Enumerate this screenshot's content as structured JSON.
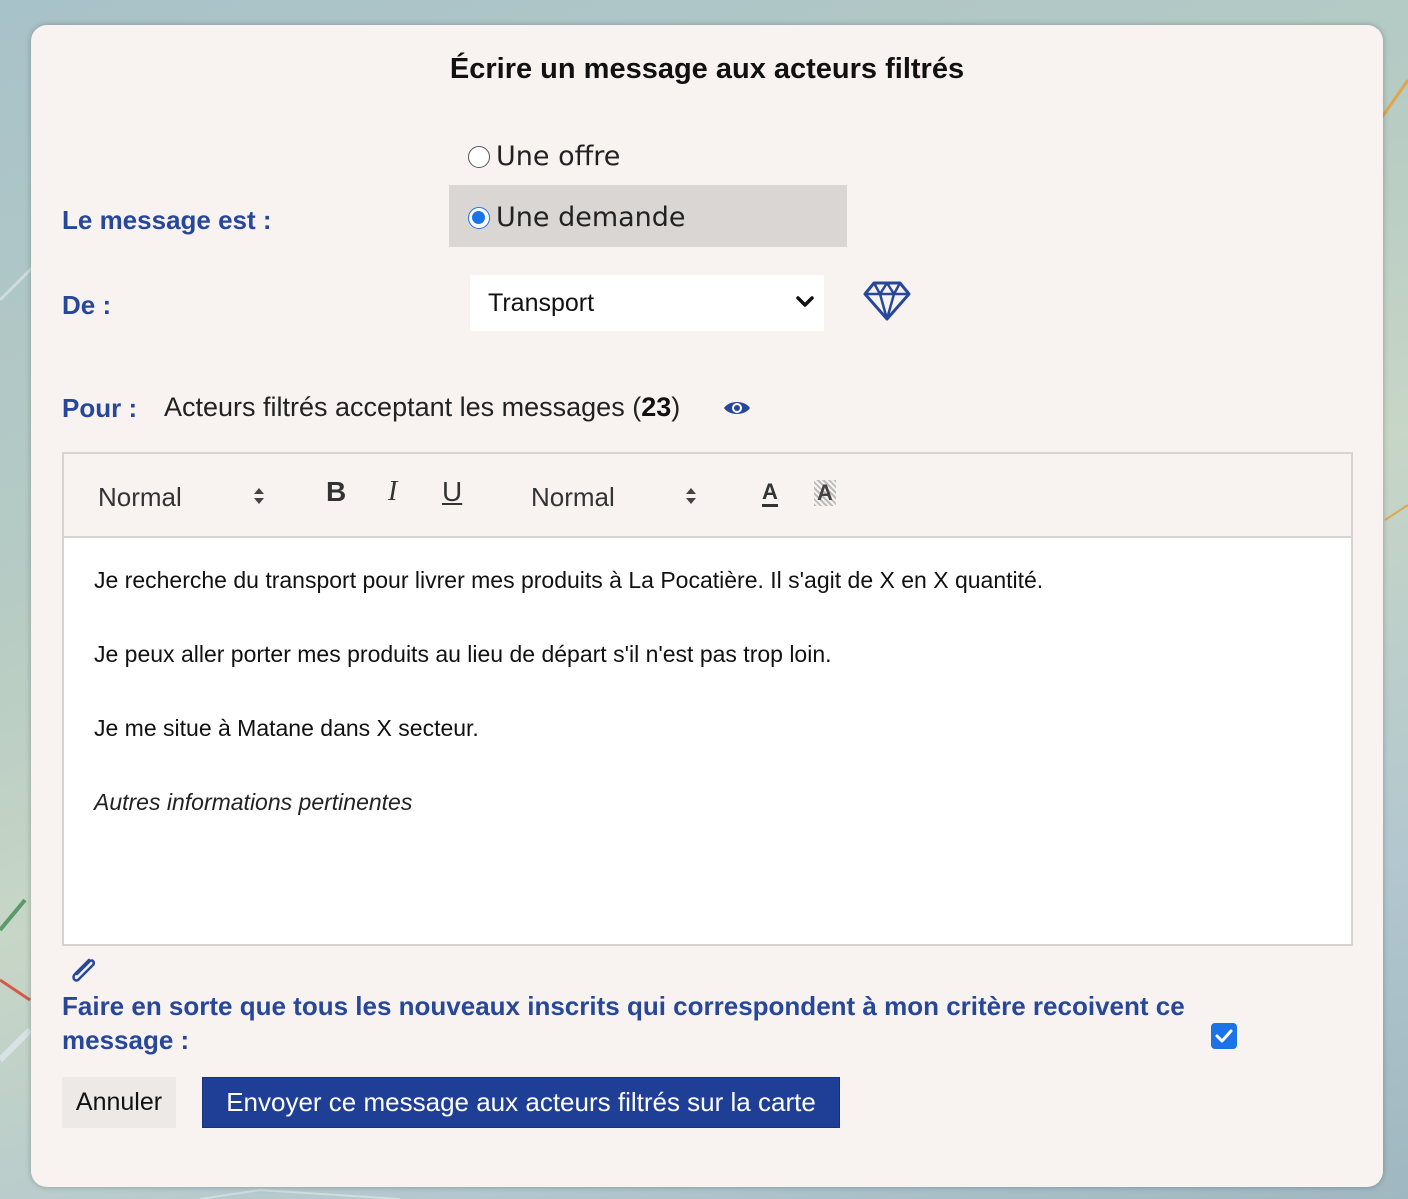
{
  "modal": {
    "title": "Écrire un message aux acteurs filtrés"
  },
  "type": {
    "label": "Le message est :",
    "options": [
      {
        "label": "Une offre",
        "checked": false
      },
      {
        "label": "Une demande",
        "checked": true
      }
    ]
  },
  "from": {
    "label": "De :",
    "selected": "Transport",
    "icon": "diamond-icon"
  },
  "to": {
    "label": "Pour :",
    "text": "Acteurs filtrés acceptant les messages (",
    "count": "23",
    "close": ")",
    "icon": "eye-icon"
  },
  "toolbar": {
    "header_select": "Normal",
    "size_select": "Normal",
    "bold": "B",
    "italic": "I",
    "underline": "U",
    "color": "A",
    "background": "A"
  },
  "editor": {
    "paragraphs": [
      "Je recherche du transport pour livrer mes produits à La Pocatière. Il s'agit de X en X quantité.",
      "Je peux aller porter mes produits au lieu de départ s'il n'est pas trop loin.",
      "Je me situe à Matane dans X secteur.",
      "Autres informations pertinentes"
    ]
  },
  "subscribe": {
    "label": "Faire en sorte que tous les nouveaux inscrits qui correspondent à mon critère recoivent ce message :",
    "checked": true
  },
  "actions": {
    "cancel": "Annuler",
    "send": "Envoyer ce message aux acteurs filtrés sur la carte"
  },
  "colors": {
    "accent": "#27489a",
    "button": "#1f3f96",
    "check": "#1b73e8"
  }
}
